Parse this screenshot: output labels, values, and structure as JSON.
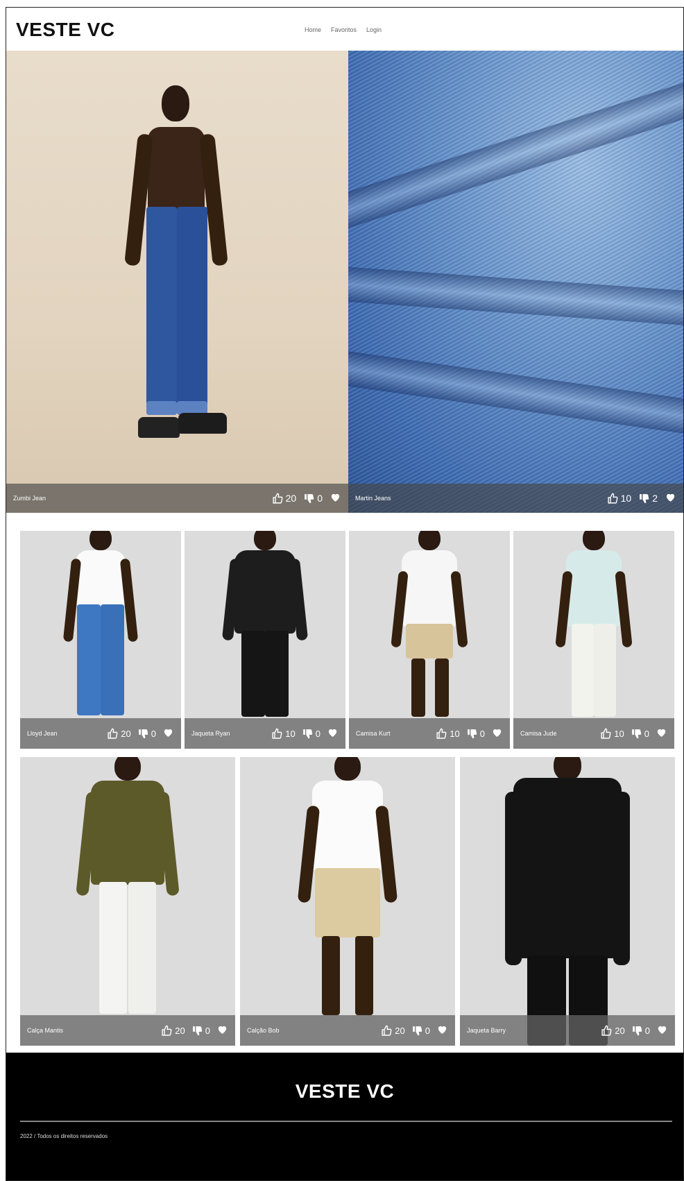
{
  "brand": {
    "name": "VESTE VC"
  },
  "nav": {
    "items": [
      "Home",
      "Favoritos",
      "Login"
    ]
  },
  "hero": [
    {
      "name": "Zumbi Jean",
      "likes": "20",
      "dislikes": "0"
    },
    {
      "name": "Martin Jeans",
      "likes": "10",
      "dislikes": "2"
    }
  ],
  "products_row1": [
    {
      "name": "Lloyd Jean",
      "likes": "20",
      "dislikes": "0"
    },
    {
      "name": "Jaqueta Ryan",
      "likes": "10",
      "dislikes": "0"
    },
    {
      "name": "Camisa Kurt",
      "likes": "10",
      "dislikes": "0"
    },
    {
      "name": "Camisa Jude",
      "likes": "10",
      "dislikes": "0"
    }
  ],
  "products_row2": [
    {
      "name": "Calça Mantis",
      "likes": "20",
      "dislikes": "0"
    },
    {
      "name": "Calção Bob",
      "likes": "20",
      "dislikes": "0"
    },
    {
      "name": "Jaqueta Barry",
      "likes": "20",
      "dislikes": "0"
    }
  ],
  "footer": {
    "brand": "VESTE VC",
    "copyright": "2022 / Todos os direitos reservados"
  },
  "colors": {
    "footer_bg": "#000000",
    "card_bg": "#dcdcdc",
    "caption_bg": "#646464"
  },
  "icons": {
    "like": "thumbs-up-icon",
    "dislike": "thumbs-down-icon",
    "favorite": "heart-icon"
  }
}
